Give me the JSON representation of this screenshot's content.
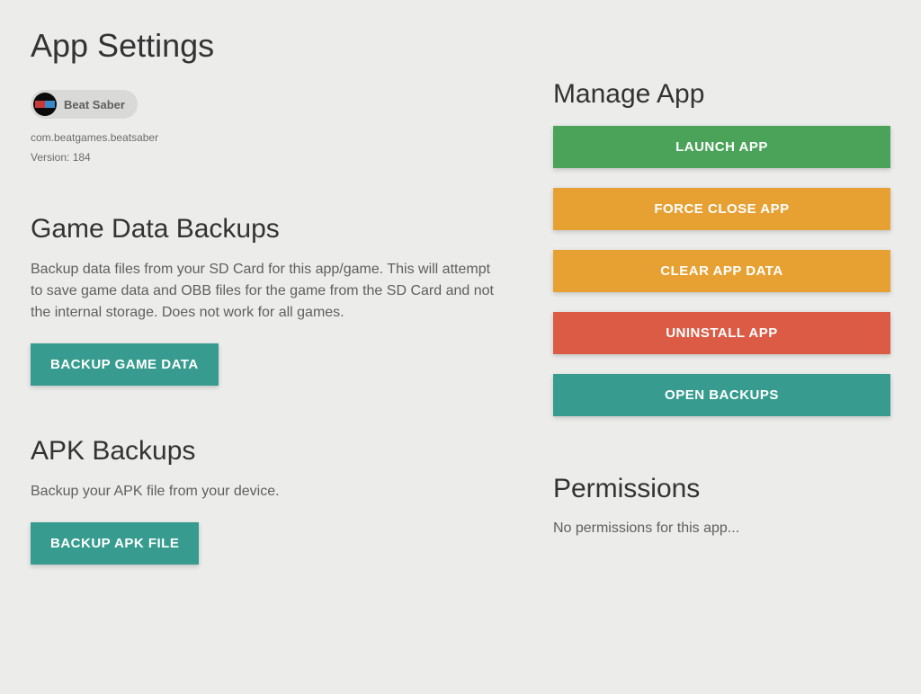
{
  "page_title": "App Settings",
  "app": {
    "name": "Beat Saber",
    "package_id": "com.beatgames.beatsaber",
    "version_label": "Version: 184"
  },
  "game_data": {
    "heading": "Game Data Backups",
    "description": "Backup data files from your SD Card for this app/game. This will attempt to save game data and OBB files for the game from the SD Card and not the internal storage. Does not work for all games.",
    "button": "BACKUP GAME DATA"
  },
  "apk": {
    "heading": "APK Backups",
    "description": "Backup your APK file from your device.",
    "button": "BACKUP APK FILE"
  },
  "manage": {
    "heading": "Manage App",
    "launch": "LAUNCH APP",
    "force_close": "FORCE CLOSE APP",
    "clear_data": "CLEAR APP DATA",
    "uninstall": "UNINSTALL APP",
    "open_backups": "OPEN BACKUPS"
  },
  "permissions": {
    "heading": "Permissions",
    "text": "No permissions for this app..."
  }
}
